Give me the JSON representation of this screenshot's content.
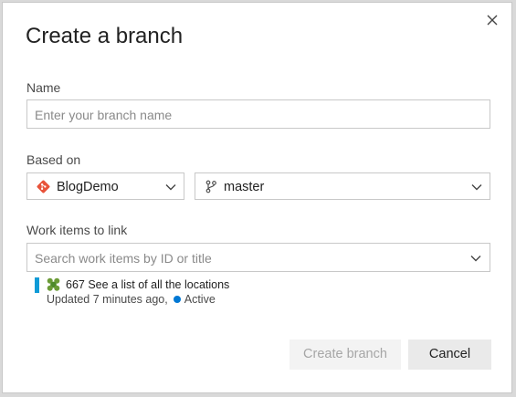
{
  "dialog": {
    "title": "Create a branch",
    "close_icon": "close-icon"
  },
  "name_field": {
    "label": "Name",
    "placeholder": "Enter your branch name",
    "value": ""
  },
  "based_on": {
    "label": "Based on",
    "repo": {
      "value": "BlogDemo",
      "icon": "git-repo-icon"
    },
    "branch": {
      "value": "master",
      "icon": "branch-icon"
    }
  },
  "work_items": {
    "label": "Work items to link",
    "placeholder": "Search work items by ID or title",
    "items": [
      {
        "id": "667",
        "title": "See a list of all the locations",
        "updated": "Updated 7 minutes ago,",
        "state": "Active",
        "type_icon": "user-story-icon",
        "bar_color": "#0f9bd7",
        "state_color": "#0078d4"
      }
    ]
  },
  "buttons": {
    "create": "Create branch",
    "cancel": "Cancel"
  }
}
